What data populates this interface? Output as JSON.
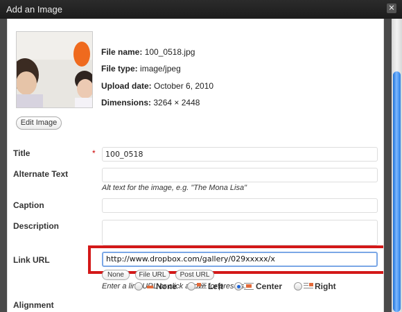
{
  "window": {
    "title": "Add an Image",
    "close_icon": "close-icon"
  },
  "media": {
    "file_name_label": "File name:",
    "file_name": "100_0518.jpg",
    "file_type_label": "File type:",
    "file_type": "image/jpeg",
    "upload_date_label": "Upload date:",
    "upload_date": "October 6, 2010",
    "dimensions_label": "Dimensions:",
    "dimensions": "3264 × 2448",
    "edit_button": "Edit Image"
  },
  "form": {
    "title_label": "Title",
    "required_marker": "*",
    "title_value": "100_0518",
    "alt_label": "Alternate Text",
    "alt_value": "",
    "alt_hint": "Alt text for the image, e.g. \"The Mona Lisa\"",
    "caption_label": "Caption",
    "caption_value": "",
    "description_label": "Description",
    "description_value": "",
    "link_label": "Link URL",
    "link_value": "http://www.dropbox.com/gallery/029xxxxx/x",
    "link_presets": [
      "None",
      "File URL",
      "Post URL"
    ],
    "link_hint": "Enter a link URL or click above for presets.",
    "alignment_label": "Alignment",
    "alignment_options": [
      "None",
      "Left",
      "Center",
      "Right"
    ],
    "alignment_selected": "Center"
  },
  "colors": {
    "highlight": "#d31818",
    "scroll_thumb": "#2a7fe6"
  }
}
